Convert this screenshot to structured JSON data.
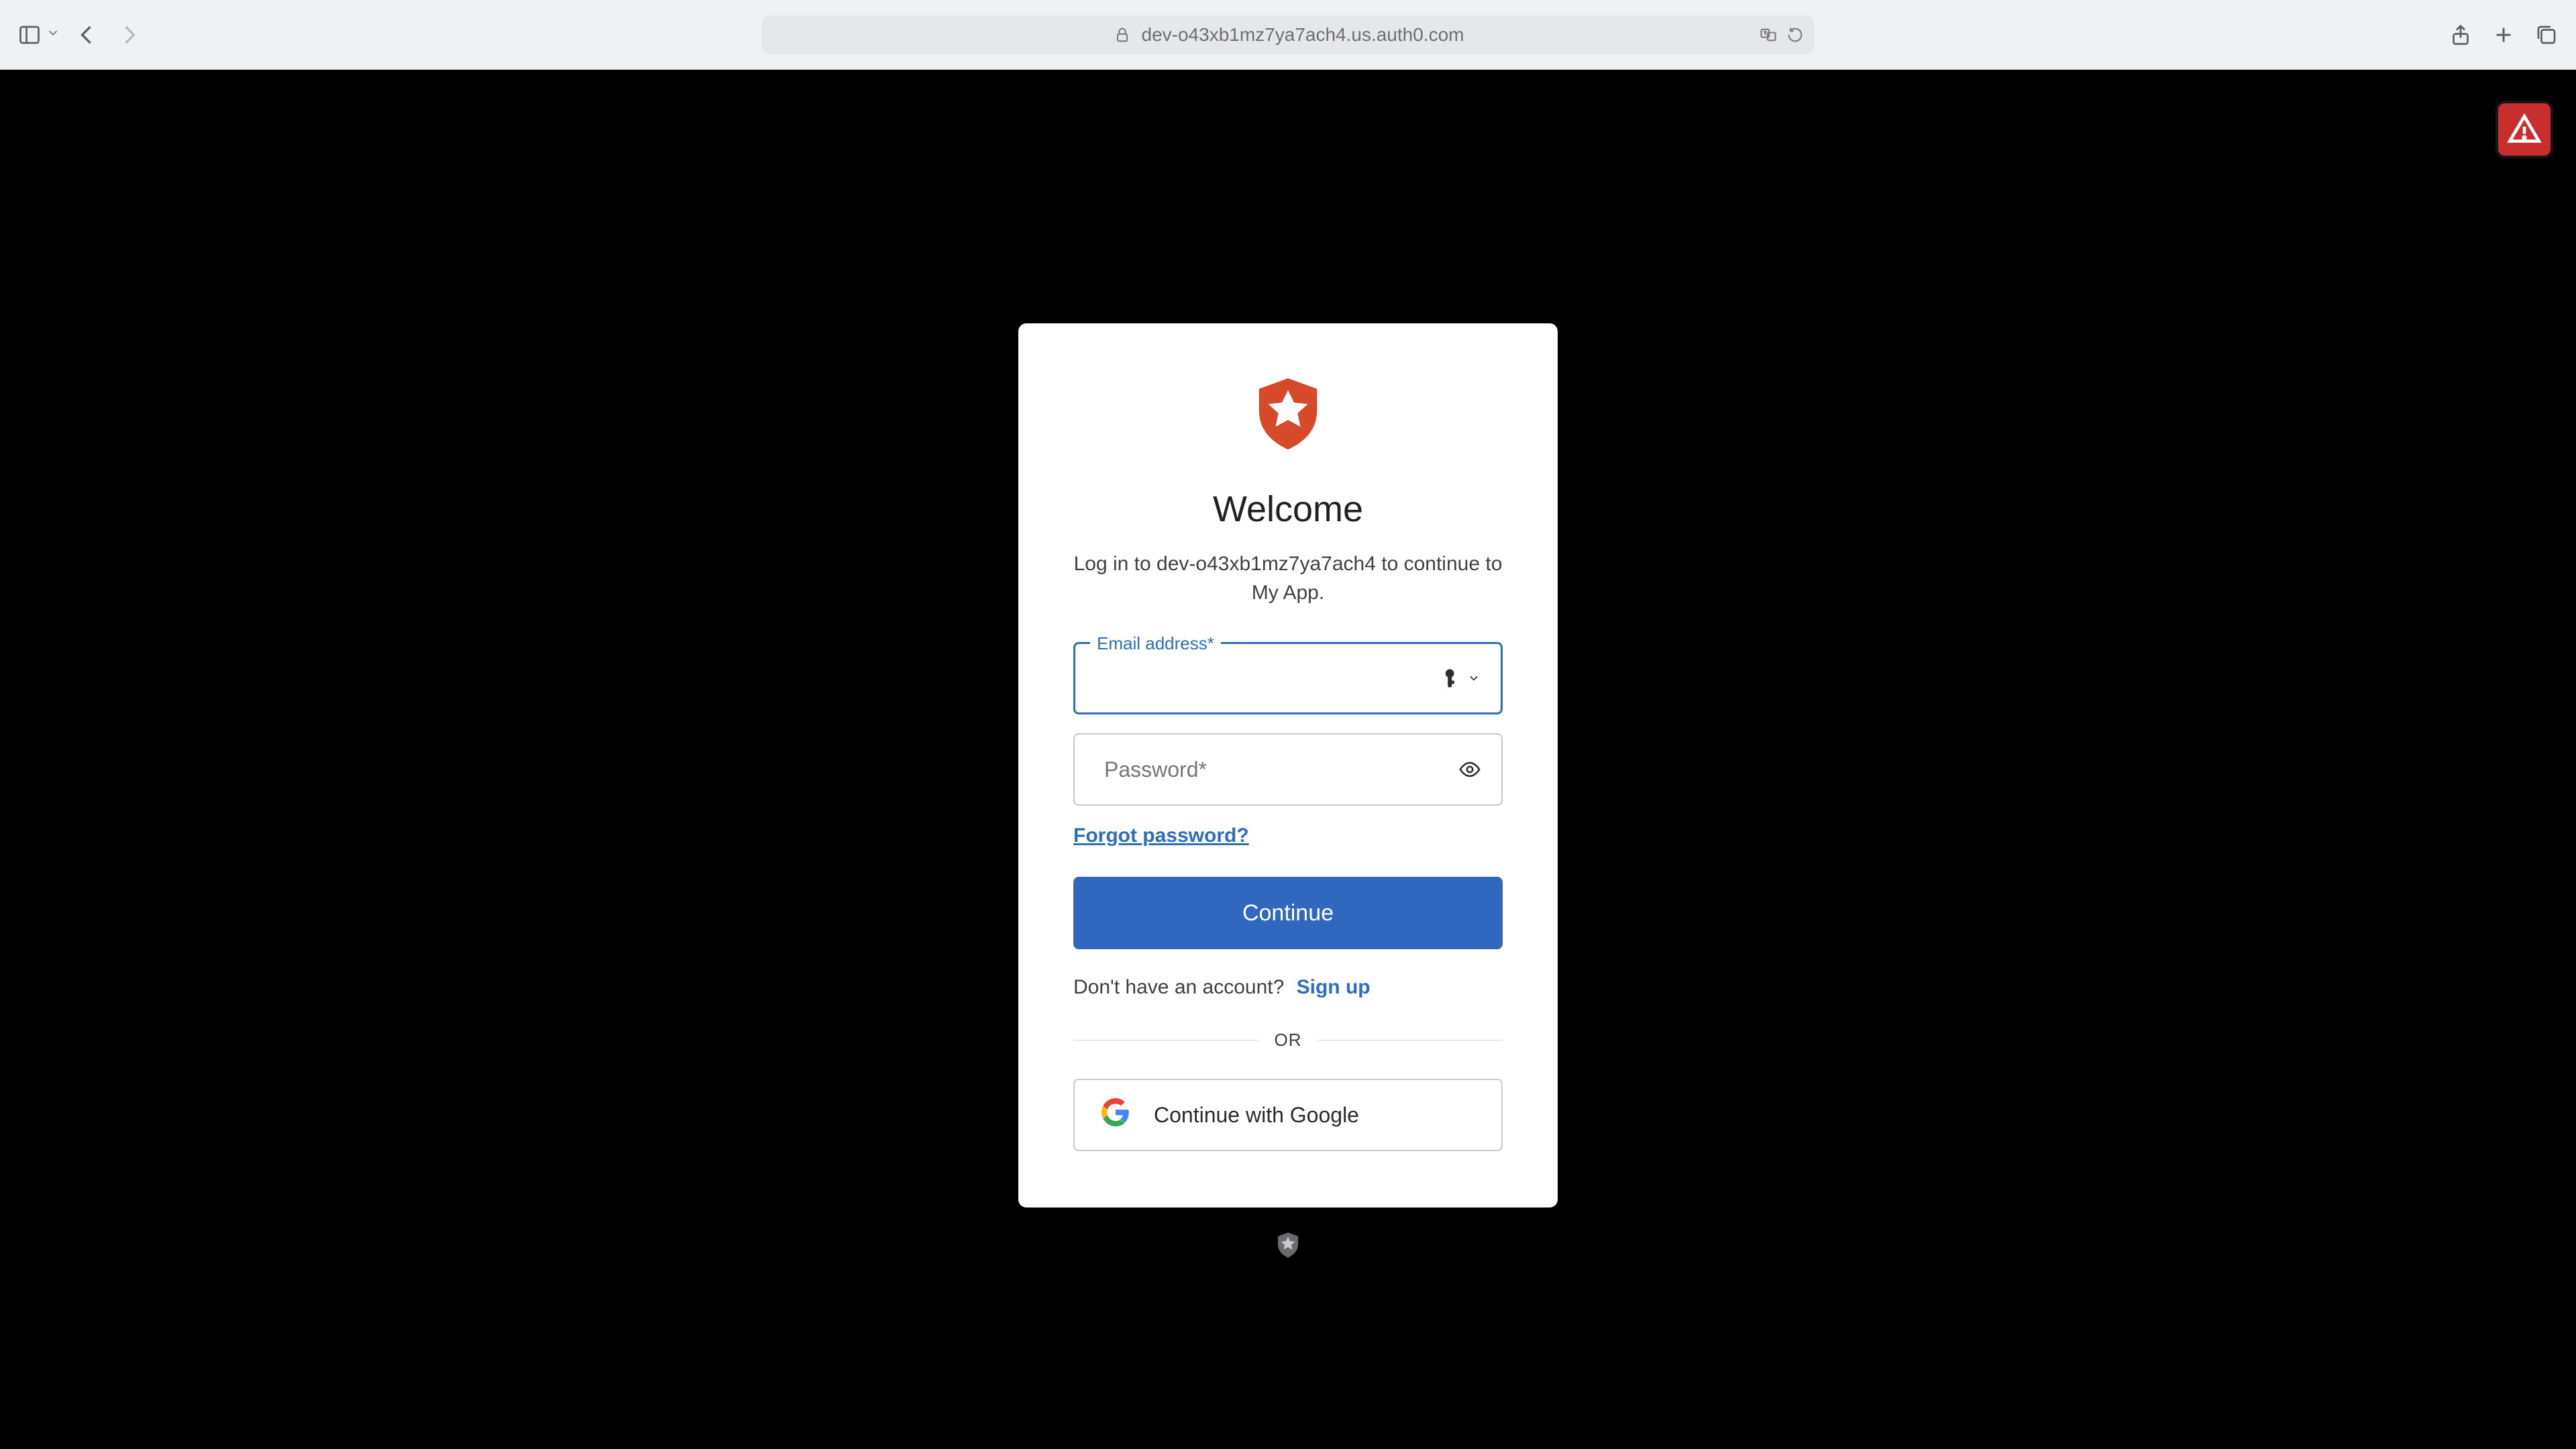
{
  "browser": {
    "url": "dev-o43xb1mz7ya7ach4.us.auth0.com"
  },
  "login": {
    "title": "Welcome",
    "subtitle": "Log in to dev-o43xb1mz7ya7ach4 to continue to My App.",
    "emailLabel": "Email address*",
    "passwordPlaceholder": "Password*",
    "forgot": "Forgot password?",
    "continue": "Continue",
    "noAccount": "Don't have an account?",
    "signup": "Sign up",
    "or": "OR",
    "google": "Continue with Google"
  },
  "colors": {
    "accent": "#2f68be",
    "link": "#2c6fbf",
    "brand": "#d64a2a",
    "danger": "#c82e2e"
  }
}
